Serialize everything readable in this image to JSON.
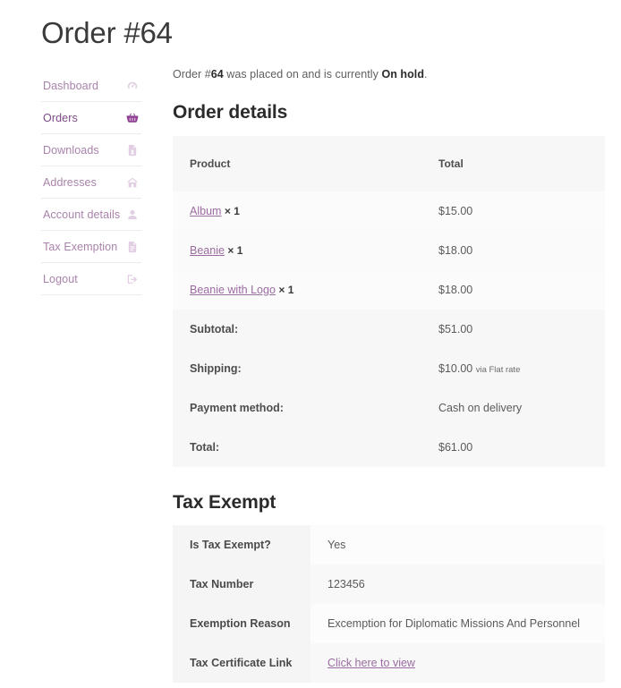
{
  "page_title": "Order #64",
  "sidebar": {
    "items": [
      {
        "label": "Dashboard",
        "icon": "gauge-icon",
        "name": "dashboard",
        "active": false
      },
      {
        "label": "Orders",
        "icon": "basket-icon",
        "name": "orders",
        "active": true
      },
      {
        "label": "Downloads",
        "icon": "download-file-icon",
        "name": "downloads",
        "active": false
      },
      {
        "label": "Addresses",
        "icon": "home-icon",
        "name": "addresses",
        "active": false
      },
      {
        "label": "Account details",
        "icon": "user-icon",
        "name": "account-details",
        "active": false
      },
      {
        "label": "Tax Exemption",
        "icon": "document-icon",
        "name": "tax-exemption",
        "active": false
      },
      {
        "label": "Logout",
        "icon": "logout-icon",
        "name": "logout",
        "active": false
      }
    ]
  },
  "main": {
    "status": {
      "prefix": "Order #",
      "order_number": "64",
      "middle": " was placed on and is currently ",
      "status_label": "On hold",
      "suffix": "."
    },
    "order_details": {
      "heading": "Order details",
      "columns": {
        "product": "Product",
        "total": "Total"
      },
      "items": [
        {
          "product": "Album",
          "qty": "× 1",
          "total": "$15.00"
        },
        {
          "product": "Beanie",
          "qty": "× 1",
          "total": "$18.00"
        },
        {
          "product": "Beanie with Logo",
          "qty": "× 1",
          "total": "$18.00"
        }
      ],
      "totals": [
        {
          "label": "Subtotal:",
          "value": "$51.00",
          "note": ""
        },
        {
          "label": "Shipping:",
          "value": "$10.00",
          "note": "via Flat rate"
        },
        {
          "label": "Payment method:",
          "value": "Cash on delivery",
          "note": ""
        },
        {
          "label": "Total:",
          "value": "$61.00",
          "note": ""
        }
      ]
    },
    "tax_exempt": {
      "heading": "Tax Exempt",
      "rows": [
        {
          "key": "Is Tax Exempt?",
          "value": "Yes",
          "link": false
        },
        {
          "key": "Tax Number",
          "value": "123456",
          "link": false
        },
        {
          "key": "Exemption Reason",
          "value": "Excemption for Diplomatic Missions And Personnel",
          "link": false
        },
        {
          "key": "Tax Certificate Link",
          "value": "Click here to view",
          "link": true
        }
      ]
    }
  },
  "colors": {
    "accent": "#9a6ba0",
    "accent_active": "#8e3f94",
    "nav_text": "#a982ab",
    "heading": "#2b2b2b"
  }
}
